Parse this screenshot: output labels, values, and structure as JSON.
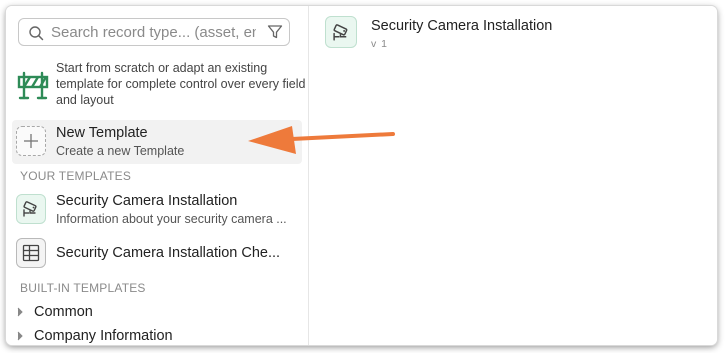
{
  "search": {
    "placeholder": "Search record type... (asset, en",
    "icon": "search-icon",
    "filter_icon": "filter-icon"
  },
  "intro": {
    "icon": "barrier-icon",
    "text": "Start from scratch or adapt an existing template for complete control over every field and layout"
  },
  "new_template": {
    "title": "New Template",
    "subtitle": "Create a new Template",
    "icon": "plus-icon"
  },
  "sections": {
    "your_templates": "YOUR TEMPLATES",
    "built_in": "BUILT-IN TEMPLATES"
  },
  "your_templates": [
    {
      "title": "Security Camera Installation",
      "subtitle": "Information about your security camera ...",
      "icon": "security-camera-icon"
    },
    {
      "title": "Security Camera Installation Che...",
      "icon": "table-icon"
    }
  ],
  "built_in": [
    {
      "label": "Common",
      "icon": "chevron-right-icon"
    },
    {
      "label": "Company Information",
      "icon": "chevron-right-icon"
    }
  ],
  "detail": {
    "title": "Security Camera Installation",
    "version": "v 1",
    "icon": "security-camera-icon"
  },
  "colors": {
    "accent_green": "#2e8b57",
    "icon_bg_green": "#eaf7f0",
    "arrow_orange": "#ee7a3b",
    "highlight": "#f2f2f2"
  }
}
